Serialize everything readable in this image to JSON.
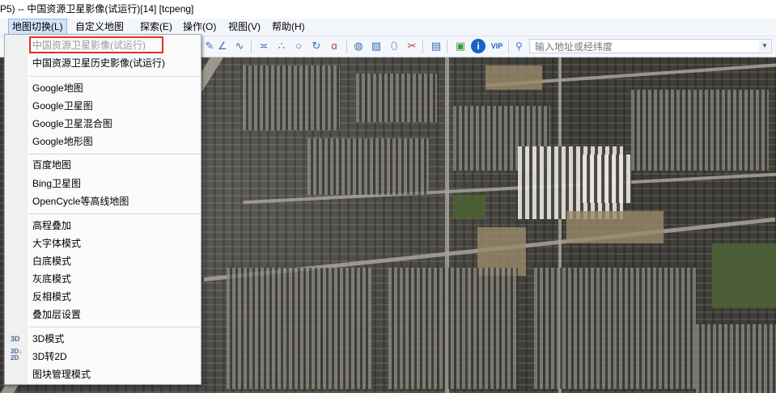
{
  "window": {
    "title": "P5) -- 中国资源卫星影像(试运行)[14] [tcpeng]"
  },
  "menubar": {
    "items": [
      {
        "label": "地图切换(L)"
      },
      {
        "label": "自定义地图"
      },
      {
        "label": "探索(E)"
      },
      {
        "label": "操作(O)"
      },
      {
        "label": "视图(V)"
      },
      {
        "label": "帮助(H)"
      }
    ]
  },
  "toolbar": {
    "address_placeholder": "输入地址或经纬度",
    "vip_label": "VIP",
    "info_label": "i",
    "dropdown_arrow": "▼"
  },
  "dropdown": {
    "items": [
      {
        "label": "中国资源卫星影像(试运行)",
        "disabled": true
      },
      {
        "label": "中国资源卫星历史影像(试运行)"
      },
      {
        "label": "Google地图"
      },
      {
        "label": "Google卫星图"
      },
      {
        "label": "Google卫星混合图"
      },
      {
        "label": "Google地形图"
      },
      {
        "label": "百度地图"
      },
      {
        "label": "Bing卫星图"
      },
      {
        "label": "OpenCycle等高线地图"
      },
      {
        "label": "高程叠加"
      },
      {
        "label": "大字体模式"
      },
      {
        "label": "白底模式"
      },
      {
        "label": "灰底模式"
      },
      {
        "label": "反相模式"
      },
      {
        "label": "叠加层设置"
      },
      {
        "label": "3D模式",
        "icon": "3D"
      },
      {
        "label": "3D转2D",
        "icon": "3D↓2D"
      },
      {
        "label": "图块管理模式"
      }
    ]
  },
  "colors": {
    "highlight_border": "#e0302b",
    "menu_active": "#cfe3fb"
  }
}
